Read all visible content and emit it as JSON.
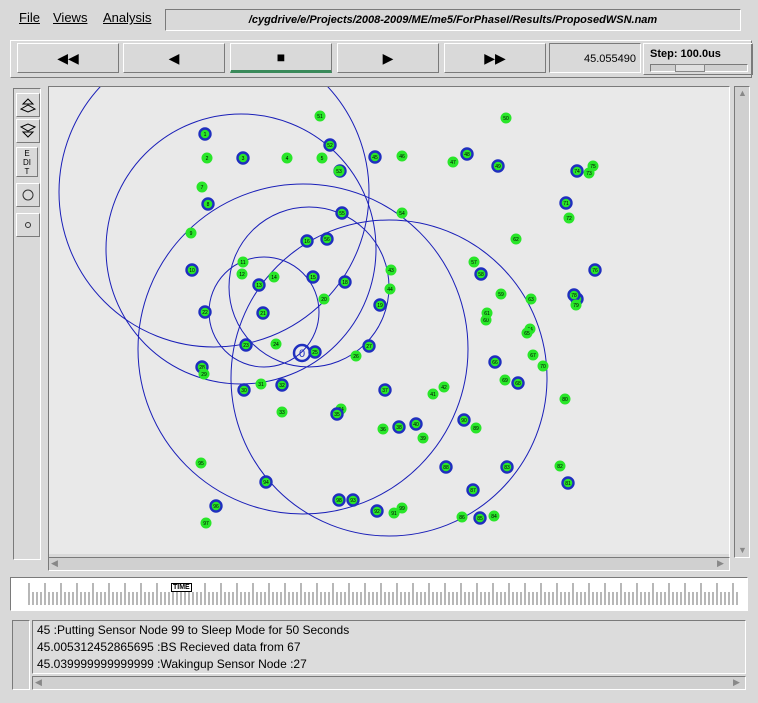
{
  "menu": {
    "file": "File",
    "views": "Views",
    "analysis": "Analysis",
    "filepath": "/cygdrive/e/Projects/2008-2009/ME/me5/ForPhaseI/Results/ProposedWSN.nam"
  },
  "controls": {
    "rewind": "◀◀",
    "back": "◀",
    "stop": "■",
    "play": "▶",
    "fast_forward": "▶▶",
    "time": "45.055490",
    "step_label": "Step: 100.0us"
  },
  "tools": {
    "edit_label": "EDIT"
  },
  "timeline": {
    "marker": "TIME"
  },
  "log": {
    "lines": [
      "45 :Putting Sensor Node 99 to Sleep Mode for 50 Seconds",
      "45.005312452865695 :BS Recieved data from 67",
      "45.039999999999999 :Wakingup Sensor Node :27"
    ]
  },
  "colors": {
    "node_green": "#29e629",
    "node_blue": "#1f2fbf",
    "circle": "#1a1fb8",
    "canvas": "#e9e9e9"
  },
  "network": {
    "base_station_label": "0",
    "nodes": [
      {
        "label": "1",
        "type": "blue"
      },
      {
        "label": "2",
        "type": "green"
      },
      {
        "label": "3",
        "type": "blue"
      },
      {
        "label": "4",
        "type": "green"
      },
      {
        "label": "5",
        "type": "green"
      },
      {
        "label": "6",
        "type": "blue"
      },
      {
        "label": "7",
        "type": "green"
      },
      {
        "label": "8",
        "type": "blue"
      },
      {
        "label": "9",
        "type": "green"
      },
      {
        "label": "10",
        "type": "blue"
      },
      {
        "label": "11",
        "type": "green"
      },
      {
        "label": "12",
        "type": "green"
      },
      {
        "label": "13",
        "type": "blue"
      },
      {
        "label": "14",
        "type": "green"
      },
      {
        "label": "15",
        "type": "blue"
      },
      {
        "label": "16",
        "type": "blue"
      },
      {
        "label": "17",
        "type": "green"
      },
      {
        "label": "18",
        "type": "blue"
      },
      {
        "label": "19",
        "type": "blue"
      },
      {
        "label": "20",
        "type": "green"
      },
      {
        "label": "21",
        "type": "blue"
      },
      {
        "label": "22",
        "type": "blue"
      },
      {
        "label": "23",
        "type": "blue"
      },
      {
        "label": "24",
        "type": "green"
      },
      {
        "label": "25",
        "type": "blue"
      },
      {
        "label": "26",
        "type": "green"
      },
      {
        "label": "27",
        "type": "blue"
      },
      {
        "label": "28",
        "type": "blue"
      },
      {
        "label": "29",
        "type": "green"
      },
      {
        "label": "30",
        "type": "blue"
      },
      {
        "label": "31",
        "type": "green"
      },
      {
        "label": "32",
        "type": "blue"
      },
      {
        "label": "33",
        "type": "green"
      },
      {
        "label": "34",
        "type": "green"
      },
      {
        "label": "35",
        "type": "blue"
      },
      {
        "label": "36",
        "type": "green"
      },
      {
        "label": "37",
        "type": "blue"
      },
      {
        "label": "38",
        "type": "blue"
      },
      {
        "label": "39",
        "type": "green"
      },
      {
        "label": "40",
        "type": "blue"
      },
      {
        "label": "41",
        "type": "green"
      },
      {
        "label": "42",
        "type": "green"
      },
      {
        "label": "43",
        "type": "green"
      },
      {
        "label": "44",
        "type": "green"
      },
      {
        "label": "45",
        "type": "blue"
      },
      {
        "label": "46",
        "type": "green"
      },
      {
        "label": "47",
        "type": "green"
      },
      {
        "label": "48",
        "type": "blue"
      },
      {
        "label": "49",
        "type": "blue"
      },
      {
        "label": "50",
        "type": "green"
      },
      {
        "label": "51",
        "type": "green"
      },
      {
        "label": "52",
        "type": "blue"
      },
      {
        "label": "53",
        "type": "green"
      },
      {
        "label": "54",
        "type": "green"
      },
      {
        "label": "55",
        "type": "blue"
      },
      {
        "label": "56",
        "type": "blue"
      },
      {
        "label": "57",
        "type": "green"
      },
      {
        "label": "58",
        "type": "blue"
      },
      {
        "label": "59",
        "type": "green"
      },
      {
        "label": "60",
        "type": "green"
      },
      {
        "label": "61",
        "type": "green"
      },
      {
        "label": "62",
        "type": "green"
      },
      {
        "label": "63",
        "type": "green"
      },
      {
        "label": "64",
        "type": "green"
      },
      {
        "label": "65",
        "type": "green"
      },
      {
        "label": "66",
        "type": "blue"
      },
      {
        "label": "67",
        "type": "green"
      },
      {
        "label": "68",
        "type": "blue"
      },
      {
        "label": "69",
        "type": "green"
      },
      {
        "label": "70",
        "type": "green"
      },
      {
        "label": "71",
        "type": "blue"
      },
      {
        "label": "72",
        "type": "green"
      },
      {
        "label": "73",
        "type": "green"
      },
      {
        "label": "74",
        "type": "blue"
      },
      {
        "label": "75",
        "type": "green"
      },
      {
        "label": "76",
        "type": "blue"
      },
      {
        "label": "77",
        "type": "blue"
      },
      {
        "label": "78",
        "type": "blue"
      },
      {
        "label": "79",
        "type": "green"
      },
      {
        "label": "80",
        "type": "green"
      },
      {
        "label": "81",
        "type": "blue"
      },
      {
        "label": "82",
        "type": "green"
      },
      {
        "label": "83",
        "type": "blue"
      },
      {
        "label": "84",
        "type": "green"
      },
      {
        "label": "85",
        "type": "blue"
      },
      {
        "label": "86",
        "type": "green"
      },
      {
        "label": "87",
        "type": "blue"
      },
      {
        "label": "88",
        "type": "blue"
      },
      {
        "label": "89",
        "type": "green"
      },
      {
        "label": "90",
        "type": "blue"
      },
      {
        "label": "91",
        "type": "green"
      },
      {
        "label": "92",
        "type": "blue"
      },
      {
        "label": "93",
        "type": "blue"
      },
      {
        "label": "94",
        "type": "blue"
      },
      {
        "label": "95",
        "type": "green"
      },
      {
        "label": "96",
        "type": "blue"
      },
      {
        "label": "97",
        "type": "green"
      },
      {
        "label": "98",
        "type": "blue"
      },
      {
        "label": "99",
        "type": "green"
      }
    ]
  }
}
